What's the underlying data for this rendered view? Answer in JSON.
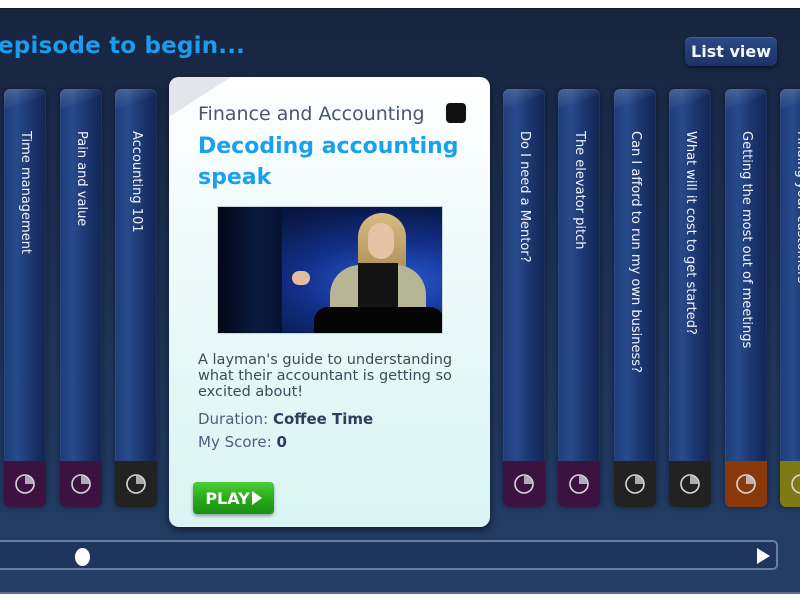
{
  "header": {
    "title": "episode to begin...",
    "list_view_label": "List view"
  },
  "left_episodes": [
    {
      "title": "Time management",
      "footer_color": "#3c1240",
      "icon": "clock-icon"
    },
    {
      "title": "Pain and value",
      "footer_color": "#3c1240",
      "icon": "clock-icon"
    },
    {
      "title": "Accounting 101",
      "footer_color": "#222222",
      "icon": "clock-icon"
    }
  ],
  "right_episodes": [
    {
      "title": "Do I need a Mentor?",
      "footer_color": "#3c1240",
      "icon": "clock-icon"
    },
    {
      "title": "The elevator pitch",
      "footer_color": "#3c1240",
      "icon": "clock-icon"
    },
    {
      "title": "Can I afford to run my own business?",
      "footer_color": "#222222",
      "icon": "clock-icon"
    },
    {
      "title": "What will it cost to get started?",
      "footer_color": "#222222",
      "icon": "clock-icon"
    },
    {
      "title": "Getting the most out of meetings",
      "footer_color": "#8a3a0a",
      "icon": "clock-icon"
    },
    {
      "title": "Finding your customers",
      "footer_color": "#7f7a14",
      "icon": "clock-icon"
    }
  ],
  "selected_episode": {
    "category": "Finance and Accounting",
    "status_color": "#111111",
    "title": "Decoding accounting speak",
    "description": "A layman's guide to understanding what their accountant is getting so excited about!",
    "duration_label": "Duration:",
    "duration_value": "Coffee Time",
    "score_label": "My Score:",
    "score_value": "0",
    "play_label": "PLAY"
  },
  "scrollbar": {
    "position_fraction": 0.1
  }
}
